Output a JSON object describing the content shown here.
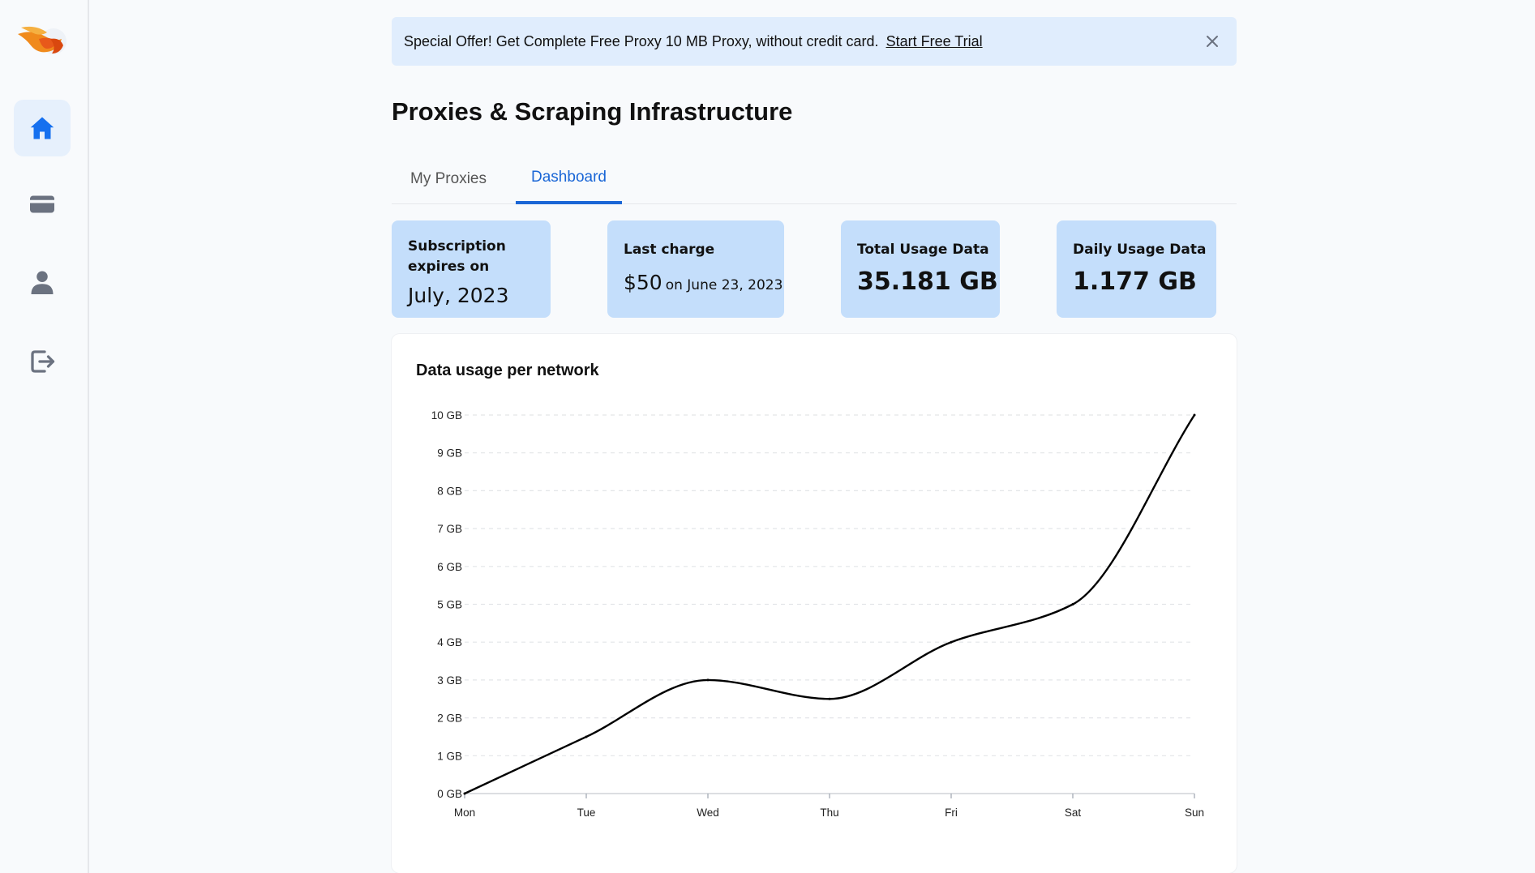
{
  "sidebar": {
    "items": [
      {
        "icon": "home-icon",
        "label": "Home",
        "active": true
      },
      {
        "icon": "credit-card-icon",
        "label": "Billing"
      },
      {
        "icon": "user-icon",
        "label": "Profile"
      },
      {
        "icon": "logout-icon",
        "label": "Logout"
      }
    ]
  },
  "banner": {
    "text": "Special Offer! Get Complete Free Proxy 10 MB Proxy, without credit card.",
    "link": "Start Free Trial"
  },
  "page": {
    "title": "Proxies & Scraping Infrastructure"
  },
  "tabs": [
    {
      "label": "My Proxies",
      "active": false
    },
    {
      "label": "Dashboard",
      "active": true
    }
  ],
  "cards": {
    "subscription": {
      "label": "Subscription expires on",
      "value": "July, 2023"
    },
    "last_charge": {
      "label": "Last charge",
      "amount": "$50",
      "date": "on June 23, 2023"
    },
    "total_usage": {
      "label": "Total Usage Data",
      "value": "35.181 GB"
    },
    "daily_usage": {
      "label": "Daily Usage Data",
      "value": "1.177 GB"
    }
  },
  "colors": {
    "accent": "#1a66d6",
    "card_bg": "#c4defb",
    "banner_bg": "#e0edfd",
    "line": "#000000"
  },
  "chart_data": {
    "type": "line",
    "title": "Data usage per network",
    "x": [
      "Mon",
      "Tue",
      "Wed",
      "Thu",
      "Fri",
      "Sat",
      "Sun"
    ],
    "series": [
      {
        "values": [
          0,
          1.5,
          3,
          2.5,
          4,
          5,
          10
        ]
      }
    ],
    "ylim": [
      0,
      10
    ],
    "yticks": [
      "0 GB",
      "1 GB",
      "2 GB",
      "3 GB",
      "4 GB",
      "5 GB",
      "6 GB",
      "7 GB",
      "8 GB",
      "9 GB",
      "10 GB"
    ],
    "grid": true,
    "legend": "none"
  }
}
